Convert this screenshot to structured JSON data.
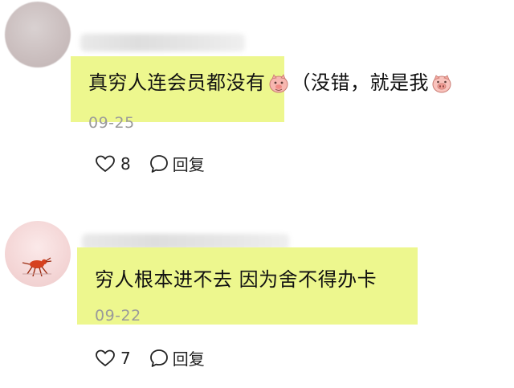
{
  "comments": [
    {
      "text": "真穷人连会员都没有",
      "text_suffix": "（没错，就是我",
      "emojis": [
        "smiling-pig-icon",
        "pig-face-icon"
      ],
      "date": "09-25",
      "likes": "8",
      "reply_label": "回复"
    },
    {
      "text": "穷人根本进不去 因为舍不得办卡",
      "date": "09-22",
      "likes": "7",
      "reply_label": "回复"
    }
  ],
  "colors": {
    "highlight": "#edf78e",
    "date": "#9a9a9a",
    "text": "#111111"
  }
}
